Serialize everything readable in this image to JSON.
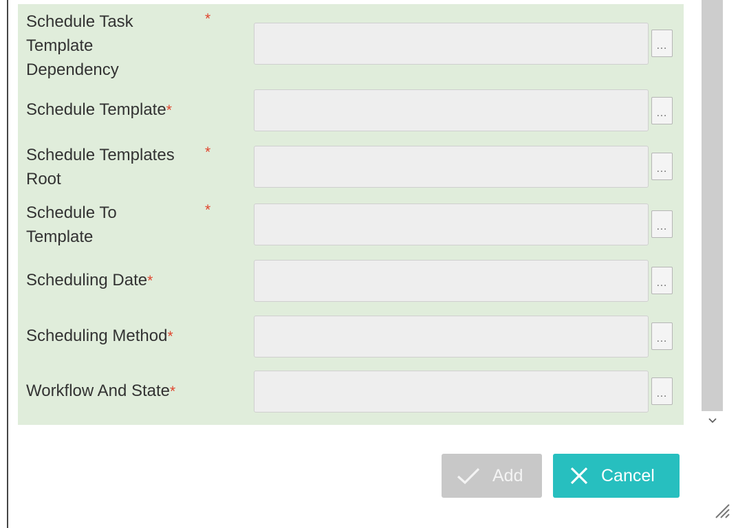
{
  "form": {
    "fields": [
      {
        "label": "Schedule Task\nTemplate\nDependency",
        "required": "*",
        "value": "",
        "lookup": "..."
      },
      {
        "label": "Schedule Template",
        "required": "*",
        "value": "",
        "lookup": "..."
      },
      {
        "label": "Schedule Templates\nRoot",
        "required": "*",
        "value": "",
        "lookup": "..."
      },
      {
        "label": "Schedule To\nTemplate",
        "required": "*",
        "value": "",
        "lookup": "..."
      },
      {
        "label": "Scheduling Date",
        "required": "*",
        "value": "",
        "lookup": "..."
      },
      {
        "label": "Scheduling Method",
        "required": "*",
        "value": "",
        "lookup": "..."
      },
      {
        "label": "Workflow And State",
        "required": "*",
        "value": "",
        "lookup": "..."
      }
    ]
  },
  "actions": {
    "add_label": "Add",
    "cancel_label": "Cancel",
    "add_icon": "check-icon",
    "cancel_icon": "close-icon"
  },
  "colors": {
    "panel_background": "#e0eddb",
    "required_marker": "#e0452d",
    "cancel_button": "#27bfbf",
    "add_button_disabled": "#c8c8c8"
  }
}
